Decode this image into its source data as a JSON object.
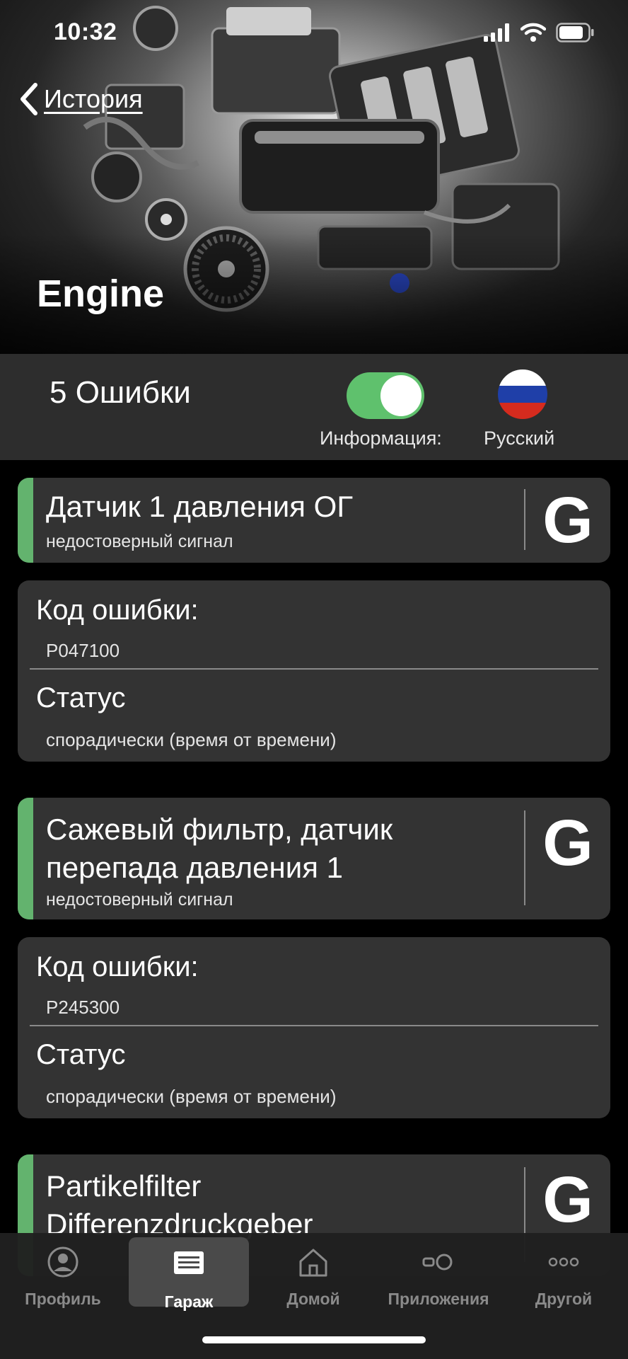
{
  "status_bar": {
    "time": "10:32"
  },
  "nav": {
    "back_label": "История"
  },
  "header": {
    "title": "Engine"
  },
  "summary": {
    "errors_count": "5 Ошибки",
    "info_toggle_label": "Информация:",
    "info_toggle_on": true,
    "language_label": "Русский",
    "flag_colors": [
      "#ffffff",
      "#1f3fa8",
      "#d52b1e"
    ]
  },
  "faults": [
    {
      "title_lines": [
        "Датчик 1 давления ОГ"
      ],
      "subtitle": "недостоверный сигнал",
      "action_label": "G",
      "code_label": "Код ошибки:",
      "code": "P047100",
      "status_label": "Статус",
      "status": "спорадически (время от времени)"
    },
    {
      "title_lines": [
        "Сажевый фильтр, датчик",
        "перепада давления 1"
      ],
      "subtitle": "недостоверный сигнал",
      "action_label": "G",
      "code_label": "Код ошибки:",
      "code": "P245300",
      "status_label": "Статус",
      "status": "спорадически (время от времени)"
    },
    {
      "title_lines": [
        "Partikelfilter",
        "Differenzdruckgeber"
      ],
      "action_label": "G"
    }
  ],
  "tabs": [
    {
      "label": "Профиль",
      "icon": "person-circle-icon",
      "active": false
    },
    {
      "label": "Гараж",
      "icon": "garage-icon",
      "active": true
    },
    {
      "label": "Домой",
      "icon": "house-icon",
      "active": false
    },
    {
      "label": "Приложения",
      "icon": "apps-icon",
      "active": false
    },
    {
      "label": "Другой",
      "icon": "more-dots-icon",
      "active": false
    }
  ],
  "colors": {
    "accent_green": "#63b36e",
    "toggle_green": "#5fc16d",
    "card_bg": "#333333",
    "summary_bg": "#2d2d2d"
  }
}
